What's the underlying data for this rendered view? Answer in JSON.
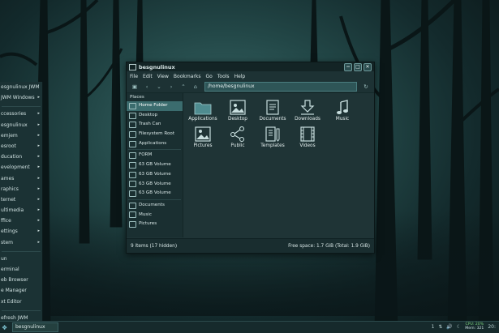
{
  "window": {
    "title": "besgnulinux",
    "buttons": {
      "minimize": "−",
      "maximize": "□",
      "close": "✕"
    },
    "menubar": [
      "File",
      "Edit",
      "View",
      "Bookmarks",
      "Go",
      "Tools",
      "Help"
    ],
    "path": "/home/besgnulinux",
    "sidebar": {
      "heading": "Places",
      "items": [
        {
          "label": "Home Folder",
          "icon": "home-icon",
          "active": true
        },
        {
          "label": "Desktop",
          "icon": "desktop-icon"
        },
        {
          "label": "Trash Can",
          "icon": "trash-icon"
        },
        {
          "label": "Filesystem Root",
          "icon": "folder-icon"
        },
        {
          "label": "Applications",
          "icon": "applications-icon"
        },
        {
          "label": "FORM",
          "icon": "drive-icon"
        },
        {
          "label": "63 GB Volume",
          "icon": "drive-icon"
        },
        {
          "label": "63 GB Volume",
          "icon": "drive-icon"
        },
        {
          "label": "63 GB Volume",
          "icon": "drive-icon"
        },
        {
          "label": "63 GB Volume",
          "icon": "drive-icon"
        },
        {
          "label": "Documents",
          "icon": "documents-icon"
        },
        {
          "label": "Music",
          "icon": "music-icon"
        },
        {
          "label": "Pictures",
          "icon": "pictures-icon"
        }
      ]
    },
    "files": [
      {
        "label": "Applications",
        "icon": "folder-icon"
      },
      {
        "label": "Desktop",
        "icon": "desktop-icon"
      },
      {
        "label": "Documents",
        "icon": "documents-icon"
      },
      {
        "label": "Downloads",
        "icon": "downloads-icon"
      },
      {
        "label": "Music",
        "icon": "music-icon"
      },
      {
        "label": "Pictures",
        "icon": "pictures-icon"
      },
      {
        "label": "Public",
        "icon": "share-icon"
      },
      {
        "label": "Templates",
        "icon": "templates-icon"
      },
      {
        "label": "Videos",
        "icon": "videos-icon"
      }
    ],
    "status_left": "9 items (17 hidden)",
    "status_right": "Free space: 1.7 GiB (Total: 1.9 GiB)"
  },
  "menu": {
    "items": [
      {
        "label": "esgnulinux JWM",
        "sub": false
      },
      {
        "label": "JWM Windows",
        "sub": true
      },
      {
        "sep": true
      },
      {
        "label": "ccessories",
        "sub": true
      },
      {
        "label": "esgnulinux",
        "sub": true
      },
      {
        "label": "emjem",
        "sub": true
      },
      {
        "label": "esroot",
        "sub": true
      },
      {
        "label": "ducation",
        "sub": true
      },
      {
        "label": "evelopment",
        "sub": true
      },
      {
        "label": "ames",
        "sub": true
      },
      {
        "label": "raphics",
        "sub": true
      },
      {
        "label": "ternet",
        "sub": true
      },
      {
        "label": "ultimedia",
        "sub": true
      },
      {
        "label": "ffice",
        "sub": true
      },
      {
        "label": "ettings",
        "sub": true
      },
      {
        "label": "stem",
        "sub": true
      },
      {
        "sep": true
      },
      {
        "label": "un",
        "sub": false
      },
      {
        "label": "erminal",
        "sub": false
      },
      {
        "label": "eb Browser",
        "sub": false
      },
      {
        "label": "e Manager",
        "sub": false
      },
      {
        "label": "xt Editor",
        "sub": false
      },
      {
        "sep": true
      },
      {
        "label": "efresh JWM",
        "sub": false
      }
    ]
  },
  "taskbar": {
    "task": "besgnulinux",
    "tray_num": "1",
    "cpu": "CPU: 20%",
    "mem": "Mem: 321",
    "clock": "20:"
  },
  "colors": {
    "accent": "#3b6c6e",
    "path_bg": "#2e5557",
    "panel": "#1f3436"
  }
}
